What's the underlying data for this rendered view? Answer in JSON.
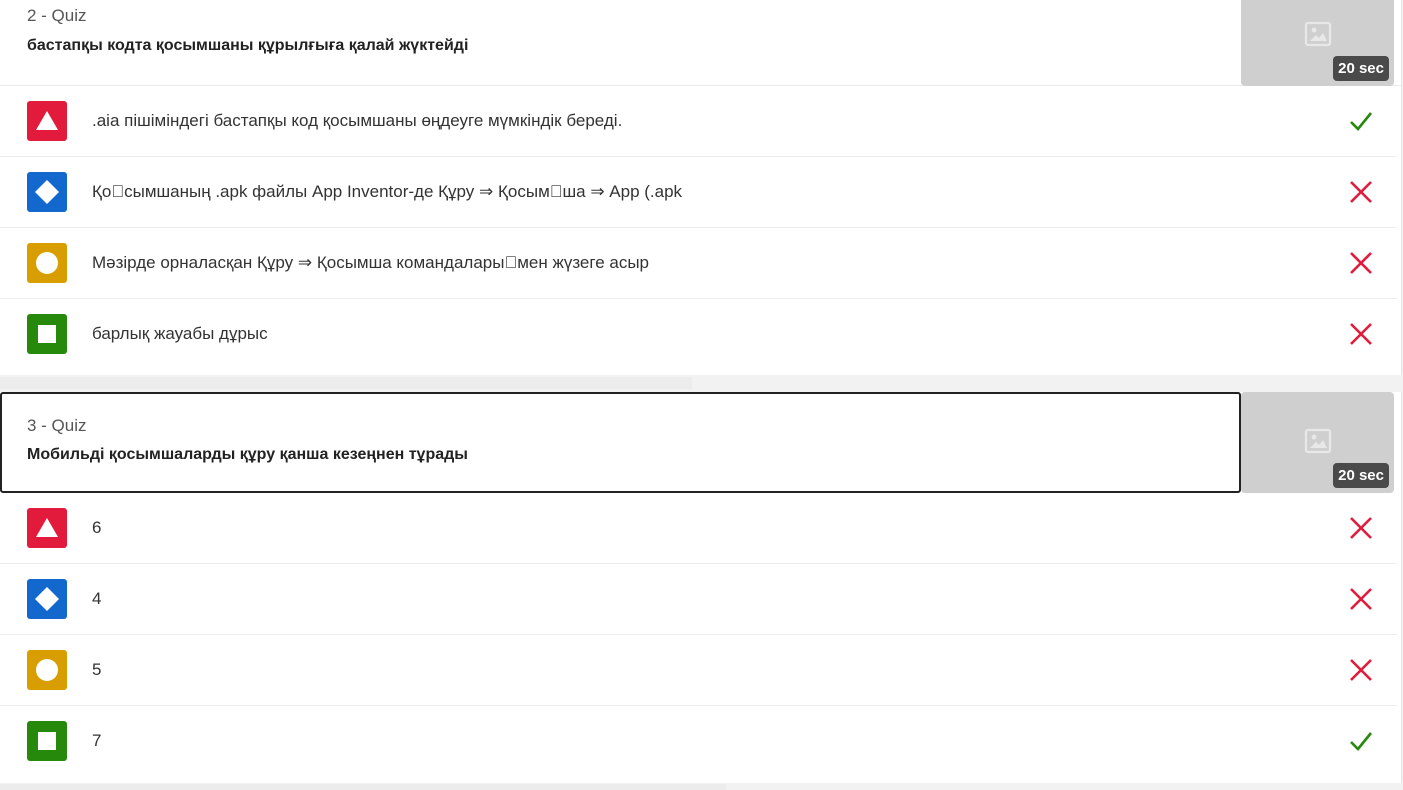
{
  "time_label": "20 sec",
  "colors": {
    "red": "#e21b3c",
    "blue": "#1368ce",
    "yellow": "#d89e00",
    "green": "#26890c",
    "correct": "#26890c",
    "wrong": "#e21b3c"
  },
  "quizzes": [
    {
      "number_label": "2 - Quiz",
      "question": "бастапқы кодта қосымшаны құрылғыға қалай жүктейді",
      "media_icon": "image-placeholder-icon",
      "options": [
        {
          "shape": "triangle-icon",
          "text": ".aia пішіміндегі бастапқы код қосымшаны өңдеуге мүмкіндік береді.",
          "result": "correct"
        },
        {
          "shape": "diamond-icon",
          "text": "Қо\u0000сымшаның .apk файлы App Inventor-де Құру ⇒ Қосым\u0000ша ⇒ App (.apk",
          "result": "wrong"
        },
        {
          "shape": "circle-icon",
          "text": "Мәзірде орналасқан Құру ⇒ Қосымша командалары\u0000мен жүзеге асыр",
          "result": "wrong"
        },
        {
          "shape": "square-icon",
          "text": "барлық жауабы дұрыс",
          "result": "wrong"
        }
      ]
    },
    {
      "number_label": "3 - Quiz",
      "question": "Мобильді қосымшаларды құру қанша кезеңнен тұрады",
      "media_icon": "image-placeholder-icon",
      "options": [
        {
          "shape": "triangle-icon",
          "text": "6",
          "result": "wrong"
        },
        {
          "shape": "diamond-icon",
          "text": "4",
          "result": "wrong"
        },
        {
          "shape": "circle-icon",
          "text": "5",
          "result": "wrong"
        },
        {
          "shape": "square-icon",
          "text": "7",
          "result": "correct"
        }
      ]
    }
  ]
}
